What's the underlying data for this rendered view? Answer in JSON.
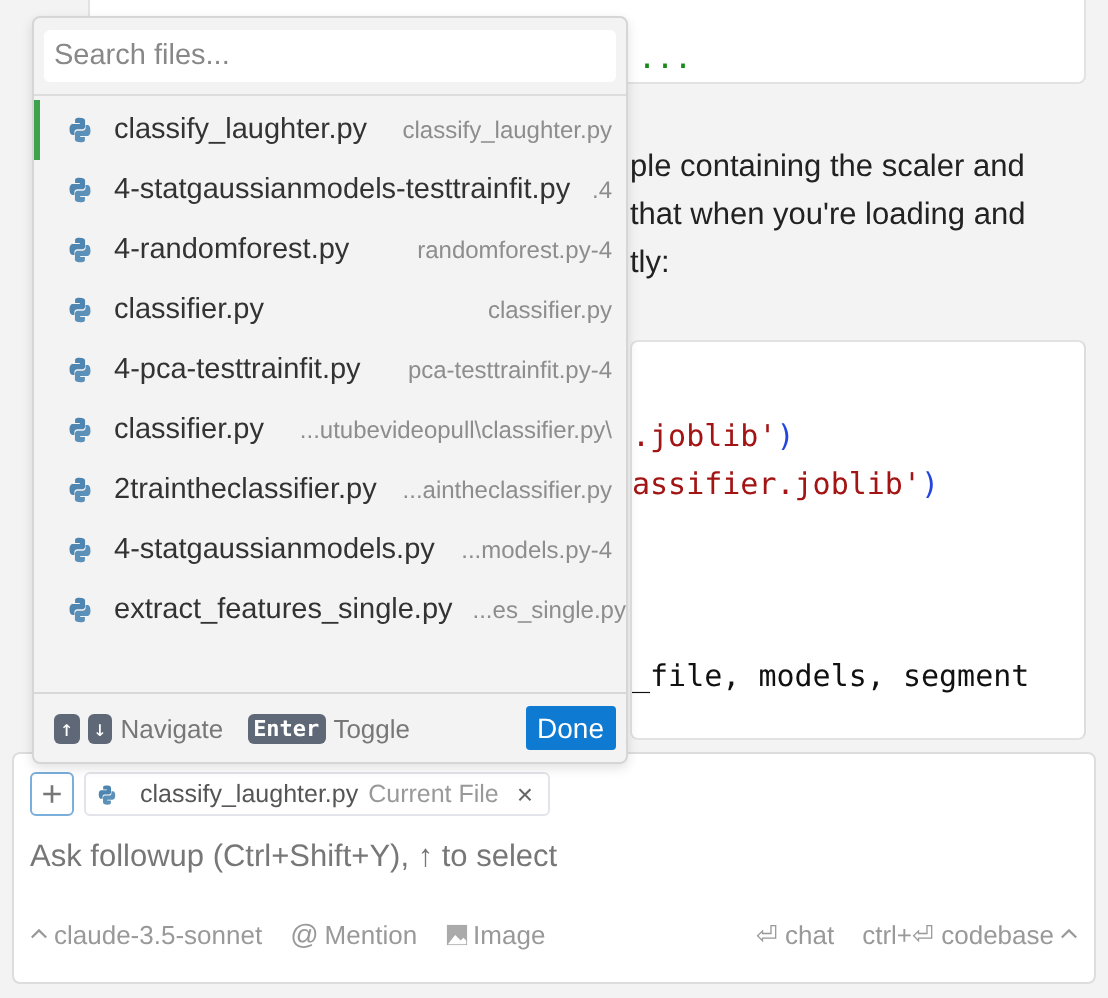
{
  "chat": {
    "top_code": "...",
    "paragraph_lines": [
      "ple containing the scaler and",
      "that when you're loading and",
      "tly:"
    ],
    "code_lines": [
      [
        {
          "kind": "string",
          "text": ".joblib'"
        },
        {
          "kind": "paren",
          "text": ")"
        }
      ],
      [
        {
          "kind": "string",
          "text": "assifier.joblib'"
        },
        {
          "kind": "paren",
          "text": ")"
        }
      ],
      [
        {
          "kind": "plain",
          "text": "_file, models, segment"
        }
      ]
    ]
  },
  "file_picker": {
    "search": {
      "placeholder": "Search files..."
    },
    "files": [
      {
        "name": "classify_laughter.py",
        "path": "classify_laughter.py",
        "selected": true
      },
      {
        "name": "4-statgaussianmodels-testtrainfit.py",
        "path": ".4",
        "selected": false
      },
      {
        "name": "4-randomforest.py",
        "path": "randomforest.py-4",
        "selected": false
      },
      {
        "name": "classifier.py",
        "path": "classifier.py",
        "selected": false
      },
      {
        "name": "4-pca-testtrainfit.py",
        "path": "pca-testtrainfit.py-4",
        "selected": false
      },
      {
        "name": "classifier.py",
        "path": "...utubevideopull\\classifier.py\\",
        "selected": false
      },
      {
        "name": "2traintheclassifier.py",
        "path": "...aintheclassifier.py",
        "selected": false
      },
      {
        "name": "4-statgaussianmodels.py",
        "path": "...models.py-4",
        "selected": false
      },
      {
        "name": "extract_features_single.py",
        "path": "...es_single.py",
        "selected": false
      }
    ],
    "footer": {
      "keys": [
        "↑",
        "↓"
      ],
      "navigate": "Navigate",
      "enter_key": "Enter",
      "toggle": "Toggle",
      "done": "Done"
    }
  },
  "composer": {
    "add": "+",
    "context_chip": {
      "file": "classify_laughter.py",
      "note": "Current File",
      "close": "×"
    },
    "input": {
      "placeholder": "Ask followup (Ctrl+Shift+Y), ↑ to select"
    },
    "model": "claude-3.5-sonnet",
    "mention_icon": "@",
    "mention": "Mention",
    "image": "Image",
    "chat": "⏎ chat",
    "codebase": "ctrl+⏎ codebase"
  }
}
